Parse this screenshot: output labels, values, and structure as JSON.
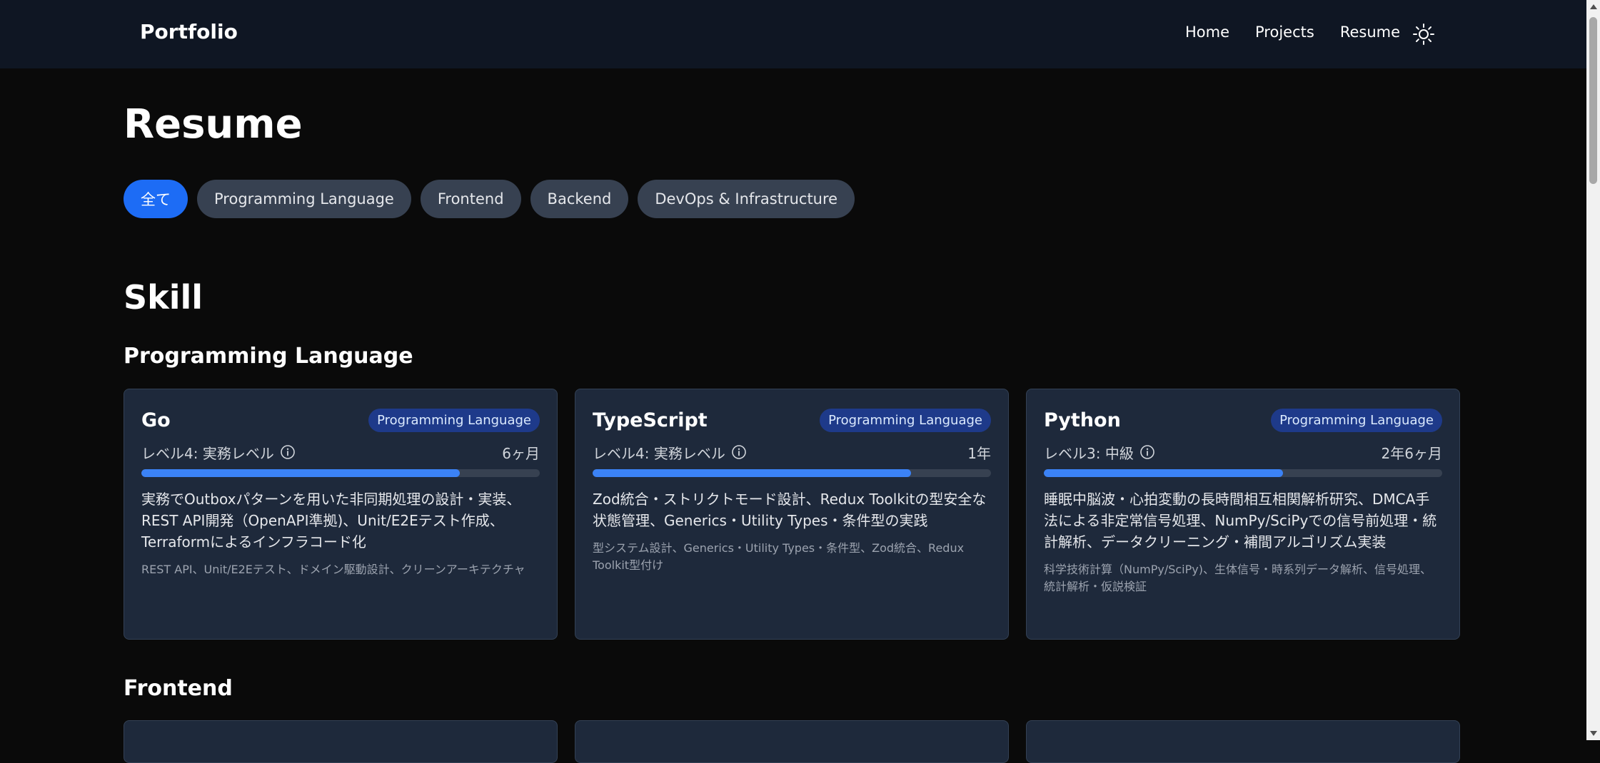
{
  "header": {
    "brand": "Portfolio",
    "nav": [
      "Home",
      "Projects",
      "Resume"
    ],
    "theme_icon": "sun-icon"
  },
  "page": {
    "title": "Resume"
  },
  "filters": [
    {
      "label": "全て",
      "active": true
    },
    {
      "label": "Programming Language",
      "active": false
    },
    {
      "label": "Frontend",
      "active": false
    },
    {
      "label": "Backend",
      "active": false
    },
    {
      "label": "DevOps & Infrastructure",
      "active": false
    }
  ],
  "skill": {
    "title": "Skill",
    "groups": [
      {
        "title": "Programming Language",
        "cards": [
          {
            "name": "Go",
            "badge": "Programming Language",
            "level": "レベル4: 実務レベル",
            "duration": "6ヶ月",
            "progress": 0.8,
            "description": "実務でOutboxパターンを用いた非同期処理の設計・実装、REST API開発（OpenAPI準拠)、Unit/E2Eテスト作成、Terraformによるインフラコード化",
            "tags": "REST API、Unit/E2Eテスト、ドメイン駆動設計、クリーンアーキテクチャ"
          },
          {
            "name": "TypeScript",
            "badge": "Programming Language",
            "level": "レベル4: 実務レベル",
            "duration": "1年",
            "progress": 0.8,
            "description": "Zod統合・ストリクトモード設計、Redux Toolkitの型安全な状態管理、Generics・Utility Types・条件型の実践",
            "tags": "型システム設計、Generics・Utility Types・条件型、Zod統合、Redux Toolkit型付け"
          },
          {
            "name": "Python",
            "badge": "Programming Language",
            "level": "レベル3: 中級",
            "duration": "2年6ヶ月",
            "progress": 0.6,
            "description": "睡眠中脳波・心拍変動の長時間相互相関解析研究、DMCA手法による非定常信号処理、NumPy/SciPyでの信号前処理・統計解析、データクリーニング・補間アルゴリズム実装",
            "tags": "科学技術計算（NumPy/SciPy)、生体信号・時系列データ解析、信号処理、統計解析・仮説検証"
          }
        ]
      },
      {
        "title": "Frontend",
        "cards": []
      }
    ]
  },
  "colors": {
    "accent": "#1d6cf5",
    "progress": "#3b82f6",
    "card_bg": "#1e293b",
    "badge_bg": "#1e3a8a"
  }
}
